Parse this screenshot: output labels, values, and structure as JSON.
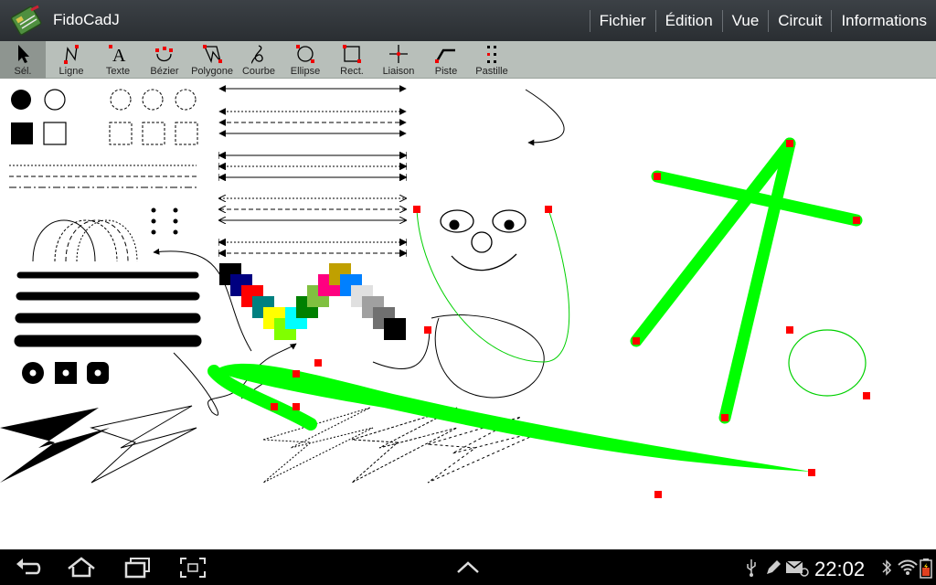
{
  "window": {
    "title": "FidoCadJ",
    "icon": "fidocadj-circuit-board-icon"
  },
  "menu": [
    {
      "label": "Fichier"
    },
    {
      "label": "Édition"
    },
    {
      "label": "Vue"
    },
    {
      "label": "Circuit"
    },
    {
      "label": "Informations"
    }
  ],
  "toolbar": {
    "selected": "select",
    "tools": [
      {
        "id": "select",
        "label": "Sél.",
        "icon": "arrow-cursor-icon"
      },
      {
        "id": "line",
        "label": "Ligne",
        "icon": "line-icon"
      },
      {
        "id": "text",
        "label": "Texte",
        "icon": "text-a-icon"
      },
      {
        "id": "bezier",
        "label": "Bézier",
        "icon": "bezier-icon"
      },
      {
        "id": "polygon",
        "label": "Polygone",
        "icon": "polygon-icon"
      },
      {
        "id": "curve",
        "label": "Courbe",
        "icon": "curve-icon"
      },
      {
        "id": "ellipse",
        "label": "Ellipse",
        "icon": "ellipse-icon"
      },
      {
        "id": "rect",
        "label": "Rect.",
        "icon": "rectangle-icon"
      },
      {
        "id": "connection",
        "label": "Liaison",
        "icon": "connection-cross-icon"
      },
      {
        "id": "track",
        "label": "Piste",
        "icon": "pcb-track-icon"
      },
      {
        "id": "pad",
        "label": "Pastille",
        "icon": "pcb-pad-icon"
      }
    ]
  },
  "colors": {
    "action_bar": "#2f3438",
    "toolbar": "#b8bfba",
    "toolbar_selected": "#8e9590",
    "pcb_track": "#00ff00",
    "handle": "#ff0000",
    "canvas": "#ffffff"
  },
  "system_bar": {
    "time": "22:02",
    "nav_buttons": [
      "back-icon",
      "home-icon",
      "recent-apps-icon",
      "screenshot-icon"
    ],
    "center_button": "chevron-up-icon",
    "status_icons": [
      "usb-icon",
      "edit-pen-icon",
      "email-icon",
      "bluetooth-icon",
      "wifi-icon",
      "battery-icon"
    ]
  }
}
